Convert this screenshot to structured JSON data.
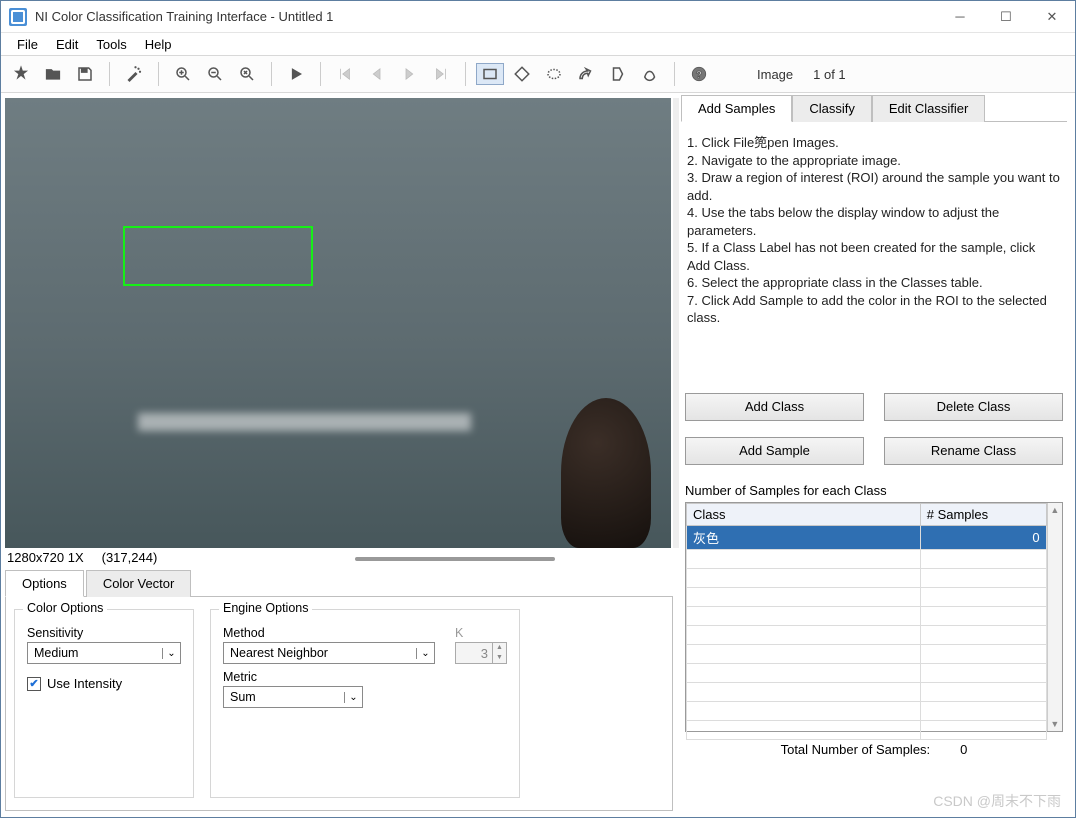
{
  "window": {
    "title": "NI Color Classification Training Interface - Untitled 1"
  },
  "menu": {
    "file": "File",
    "edit": "Edit",
    "tools": "Tools",
    "help": "Help"
  },
  "toolbar": {
    "image_label": "Image",
    "counter": "1  of  1"
  },
  "status": {
    "dim": "1280x720 1X",
    "pos": "(317,244)"
  },
  "bottom_tabs": {
    "options": "Options",
    "color_vector": "Color Vector"
  },
  "color_options": {
    "title": "Color Options",
    "sensitivity_label": "Sensitivity",
    "sensitivity_value": "Medium",
    "use_intensity": "Use Intensity"
  },
  "engine_options": {
    "title": "Engine Options",
    "method_label": "Method",
    "method_value": "Nearest Neighbor",
    "metric_label": "Metric",
    "metric_value": "Sum",
    "k_label": "K",
    "k_value": "3"
  },
  "right_tabs": {
    "add": "Add Samples",
    "classify": "Classify",
    "edit": "Edit Classifier"
  },
  "instructions": {
    "l1": "1. Click File篼pen Images.",
    "l2": "2. Navigate to the appropriate image.",
    "l3": "3. Draw a region of interest (ROI) around the sample you want to add.",
    "l4": "4. Use the tabs below the display window to adjust the parameters.",
    "l5": "5. If a Class Label has not been created for the sample, click Add Class.",
    "l6": "6. Select the appropriate class in the Classes table.",
    "l7": "7. Click Add Sample to add the color in the ROI to the selected class."
  },
  "buttons": {
    "add_class": "Add Class",
    "delete_class": "Delete Class",
    "add_sample": "Add Sample",
    "rename_class": "Rename Class"
  },
  "table": {
    "label": "Number of Samples for each Class",
    "col_class": "Class",
    "col_samples": "# Samples",
    "rows": [
      {
        "class": "灰色",
        "samples": "0"
      }
    ]
  },
  "totals": {
    "label": "Total Number of Samples:",
    "value": "0"
  },
  "watermark": "CSDN @周末不下雨"
}
